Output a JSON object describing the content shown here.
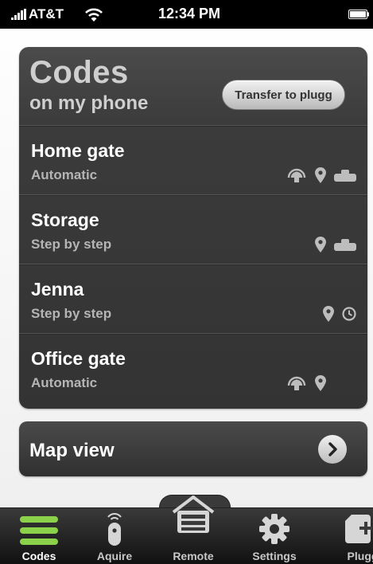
{
  "status_bar": {
    "carrier": "AT&T",
    "time": "12:34 PM"
  },
  "codes_panel": {
    "title": "Codes",
    "subtitle": "on my phone",
    "transfer_label": "Transfer to plugg",
    "codes": [
      {
        "name": "Home gate",
        "mode": "Automatic",
        "icons": [
          "gate-sensor-icon",
          "location-pin-icon",
          "remote-icon"
        ]
      },
      {
        "name": "Storage",
        "mode": "Step by step",
        "icons": [
          "location-pin-icon",
          "remote-icon"
        ]
      },
      {
        "name": "Jenna",
        "mode": "Step by step",
        "icons": [
          "location-pin-icon",
          "clock-icon"
        ]
      },
      {
        "name": "Office gate",
        "mode": "Automatic",
        "icons": [
          "gate-sensor-icon",
          "location-pin-icon"
        ]
      }
    ]
  },
  "map_view": {
    "label": "Map view"
  },
  "tab_bar": {
    "tabs": [
      {
        "label": "Codes",
        "icon": "codes-list-icon",
        "active": true
      },
      {
        "label": "Aquire",
        "icon": "remote-fob-icon",
        "active": false
      },
      {
        "label": "Remote",
        "icon": "garage-remote-icon",
        "active": false
      },
      {
        "label": "Settings",
        "icon": "gear-icon",
        "active": false
      },
      {
        "label": "Plugg",
        "icon": "plugg-add-icon",
        "active": false
      }
    ]
  },
  "colors": {
    "accent_green": "#8bd14a",
    "panel": "#3b3b3b",
    "text_light": "#ffffff",
    "text_muted": "#b5b5b5"
  }
}
